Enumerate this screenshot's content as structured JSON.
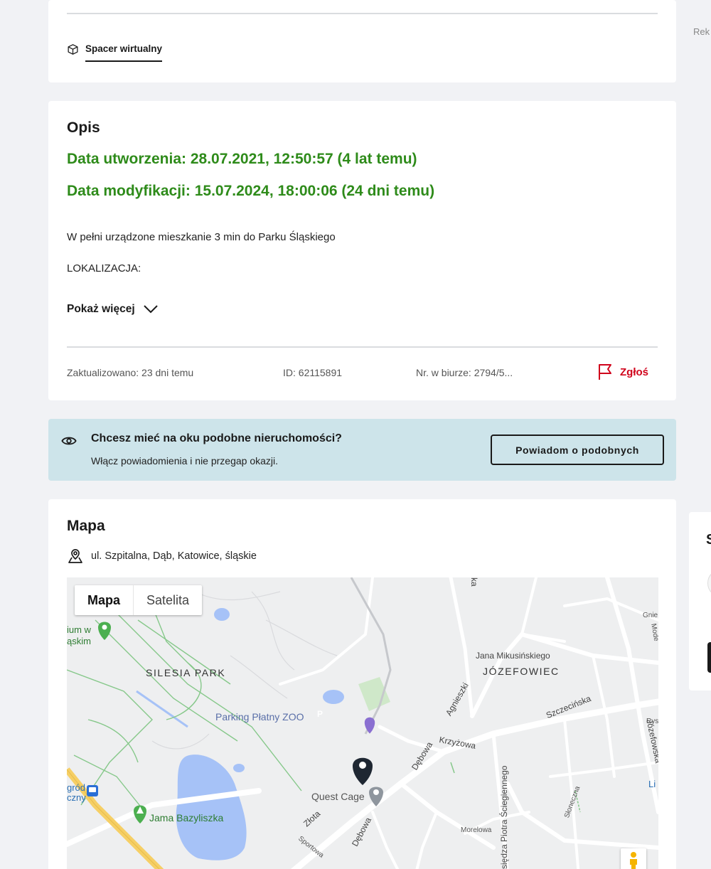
{
  "top_card": {
    "virtual_tour_label": "Spacer wirtualny"
  },
  "side": {
    "ad_label": "Rek",
    "side_card_letter": "S"
  },
  "description": {
    "title": "Opis",
    "created": "Data utworzenia: 28.07.2021, 12:50:57 (4 lat temu)",
    "modified": "Data modyfikacji: 15.07.2024, 18:00:06 (24 dni temu)",
    "paragraph1": "W pełni urządzone mieszkanie 3 min do Parku Śląskiego",
    "paragraph2": "LOKALIZACJA:",
    "show_more": "Pokaż więcej",
    "updated": "Zaktualizowano: 23 dni temu",
    "id": "ID: 62115891",
    "office_no": "Nr. w biurze: 2794/5...",
    "report": "Zgłoś",
    "accent_color": "#2e8b1a",
    "report_color": "#d0021b"
  },
  "alert": {
    "title": "Chcesz mieć na oku podobne nieruchomości?",
    "subtitle": "Włącz powiadomienia i nie przegap okazji.",
    "button": "Powiadom o podobnych",
    "background": "#cde4ea"
  },
  "map": {
    "title": "Mapa",
    "address": "ul. Szpitalna, Dąb, Katowice, śląskie",
    "toggle": {
      "map": "Mapa",
      "satellite": "Satelita"
    },
    "labels": {
      "silesia_park": "SILESIA PARK",
      "jozefowiec": "JÓZEFOWIEC",
      "parking": "Parking Płatny ZOO",
      "quest_cage": "Quest Cage",
      "jama": "Jama Bazyliszka",
      "jana": "Jana Mikusińskiego",
      "szczecinska": "Szczecińska",
      "krzyzowa": "Krzyżowa",
      "debowa1": "Dębowa",
      "debowa2": "Dębowa",
      "agnieszki": "Agnieszki",
      "zlota": "Złota",
      "sportowa": "Sportowa",
      "morelowa": "Morelowa",
      "slonecznaa": "Słoneczna",
      "ks_piotra": "Księdza Piotra Ściegiennego",
      "jozefowska": "Józefowska",
      "edge_ium": "ium w",
      "edge_askim": "ąskim",
      "edge_grod": "gród",
      "edge_czny": "czny",
      "edge_ka": "ka",
      "edge_gnie": "Gnie",
      "edge_mode": "Mode",
      "edge_rys": "Rys",
      "edge_li": "Li"
    }
  }
}
